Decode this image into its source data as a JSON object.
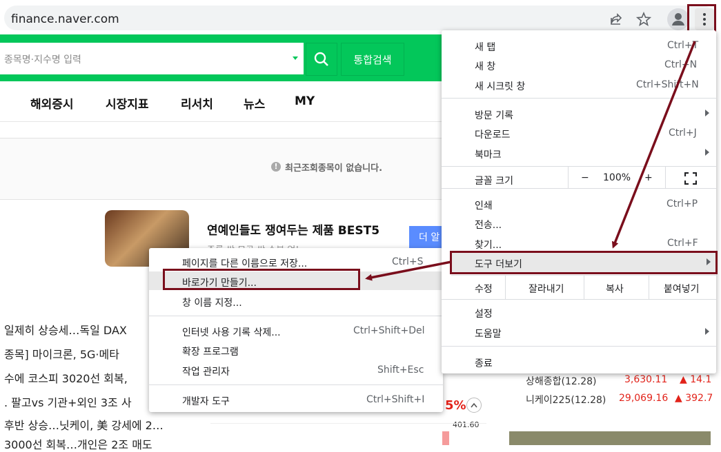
{
  "browser": {
    "url": "finance.naver.com",
    "icons": [
      "share-icon",
      "star-icon",
      "profile-icon",
      "more-vert-icon"
    ]
  },
  "page": {
    "search": {
      "placeholder": "종목명·지수명 입력",
      "button": "통합검색"
    },
    "nav": [
      "해외증시",
      "시장지표",
      "리서치",
      "뉴스",
      "MY"
    ],
    "recent_empty": "최근조회종목이 없습니다.",
    "ad": {
      "title": "연예인들도 쟁여두는 제품 BEST5",
      "subtitle": "주름 싹 모공 싹 수분 업!",
      "button": "더 알"
    },
    "news": [
      "일제히 상승세…독일 DAX",
      "종목] 마이크론, 5G·메타",
      "수에 코스피 3020선 회복,",
      ". 팔고vs 기관+외인 3조 사",
      "후반 상승…닛케이, 美 강세에 2…",
      "3000선 회복…개인은 2조 매도"
    ],
    "percent": "5%",
    "chart_value": "401.60",
    "indices": [
      {
        "name": "상해종합(12.28)",
        "value": "3,630.11",
        "change": "▲ 14.1"
      },
      {
        "name": "니케이225(12.28)",
        "value": "29,069.16",
        "change": "▲ 392.7"
      }
    ]
  },
  "chrome_menu": {
    "new_tab": {
      "label": "새 탭",
      "shortcut": "Ctrl+T"
    },
    "new_window": {
      "label": "새 창",
      "shortcut": "Ctrl+N"
    },
    "incognito": {
      "label": "새 시크릿 창",
      "shortcut": "Ctrl+Shift+N"
    },
    "history": {
      "label": "방문 기록"
    },
    "downloads": {
      "label": "다운로드",
      "shortcut": "Ctrl+J"
    },
    "bookmarks": {
      "label": "북마크"
    },
    "zoom": {
      "label": "글꼴 크기",
      "minus": "−",
      "value": "100%",
      "plus": "+"
    },
    "print": {
      "label": "인쇄",
      "shortcut": "Ctrl+P"
    },
    "cast": {
      "label": "전송..."
    },
    "find": {
      "label": "찾기...",
      "shortcut": "Ctrl+F"
    },
    "more_tools": {
      "label": "도구 더보기"
    },
    "edit": {
      "label": "수정",
      "cut": "잘라내기",
      "copy": "복사",
      "paste": "붙여넣기"
    },
    "settings": {
      "label": "설정"
    },
    "help": {
      "label": "도움말"
    },
    "exit": {
      "label": "종료"
    }
  },
  "more_tools_menu": {
    "save_page": {
      "label": "페이지를 다른 이름으로 저장...",
      "shortcut": "Ctrl+S"
    },
    "create_shortcut": {
      "label": "바로가기 만들기..."
    },
    "name_window": {
      "label": "창 이름 지정..."
    },
    "clear_data": {
      "label": "인터넷 사용 기록 삭제...",
      "shortcut": "Ctrl+Shift+Del"
    },
    "extensions": {
      "label": "확장 프로그램"
    },
    "task_manager": {
      "label": "작업 관리자",
      "shortcut": "Shift+Esc"
    },
    "devtools": {
      "label": "개발자 도구",
      "shortcut": "Ctrl+Shift+I"
    }
  },
  "colors": {
    "naver_green": "#03c75a",
    "annotation": "#7a0e1c",
    "up_red": "#e2231a"
  }
}
